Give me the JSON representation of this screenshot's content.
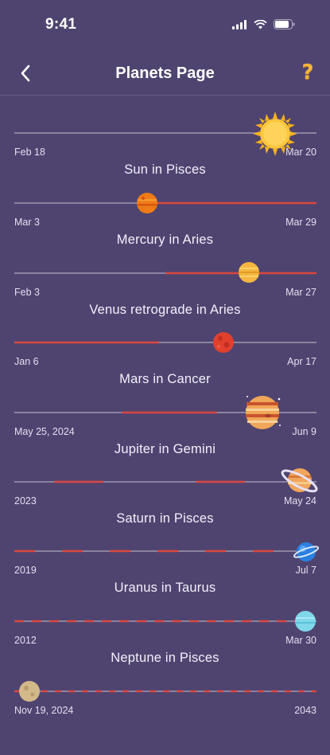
{
  "status_bar": {
    "time": "9:41"
  },
  "header": {
    "title": "Planets Page",
    "help": "?"
  },
  "rows": [
    {
      "title": "Sun in Pisces",
      "start": "Feb 18",
      "end": "Mar 20",
      "progress": 0.87,
      "icon": "sun-icon"
    },
    {
      "title": "Mercury in Aries",
      "start": "Mar 3",
      "end": "Mar 29",
      "progress": 0.44,
      "icon": "mercury-icon"
    },
    {
      "title": "Venus retrograde in Aries",
      "start": "Feb 3",
      "end": "Mar 27",
      "progress": 0.78,
      "icon": "venus-icon"
    },
    {
      "title": "Mars in Cancer",
      "start": "Jan 6",
      "end": "Apr 17",
      "progress": 0.69,
      "icon": "mars-icon"
    },
    {
      "title": "Jupiter in Gemini",
      "start": "May 25, 2024",
      "end": "Jun 9",
      "progress": 0.82,
      "icon": "jupiter-icon"
    },
    {
      "title": "Saturn in Pisces",
      "start": "2023",
      "end": "May 24",
      "progress": 0.96,
      "icon": "saturn-icon"
    },
    {
      "title": "Uranus in Taurus",
      "start": "2019",
      "end": "Jul 7",
      "progress": 0.97,
      "icon": "uranus-icon"
    },
    {
      "title": "Neptune in Pisces",
      "start": "2012",
      "end": "Mar 30",
      "progress": 0.97,
      "icon": "neptune-icon"
    },
    {
      "title": "",
      "start": "Nov 19, 2024",
      "end": "2043",
      "progress": 0.05,
      "icon": "pluto-icon"
    }
  ],
  "colors": {
    "background": "#4f4470",
    "track": "#8a84a0",
    "progress": "#d9473f",
    "help": "#f5b43c"
  }
}
